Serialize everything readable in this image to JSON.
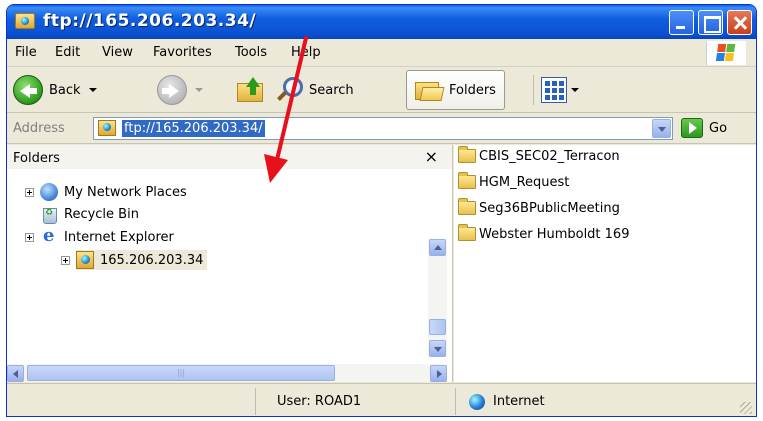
{
  "window": {
    "title": "ftp://165.206.203.34/"
  },
  "menu": {
    "items": [
      "File",
      "Edit",
      "View",
      "Favorites",
      "Tools",
      "Help"
    ]
  },
  "toolbar": {
    "back_label": "Back",
    "search_label": "Search",
    "folders_label": "Folders"
  },
  "address": {
    "label": "Address",
    "value": "ftp://165.206.203.34/",
    "go_label": "Go"
  },
  "folders_pane": {
    "title": "Folders",
    "close_glyph": "×",
    "tree": [
      {
        "label": "My Network Places",
        "icon": "network-places-icon",
        "expandable": true
      },
      {
        "label": "Recycle Bin",
        "icon": "recycle-bin-icon",
        "expandable": false
      },
      {
        "label": "Internet Explorer",
        "icon": "internet-explorer-icon",
        "expandable": true
      },
      {
        "label": "165.206.203.34",
        "icon": "ftp-site-icon",
        "expandable": true
      }
    ]
  },
  "files": [
    {
      "name": "CBIS_SEC02_Terracon",
      "icon": "folder-icon"
    },
    {
      "name": "HGM_Request",
      "icon": "folder-icon"
    },
    {
      "name": "Seg36BPublicMeeting",
      "icon": "folder-icon"
    },
    {
      "name": "Webster Humboldt 169",
      "icon": "folder-icon"
    }
  ],
  "status": {
    "user": "User: ROAD1",
    "zone": "Internet"
  },
  "colors": {
    "title_bar": "#0a50d0",
    "selection": "#316ac5",
    "annotation_arrow": "#e8101c"
  }
}
